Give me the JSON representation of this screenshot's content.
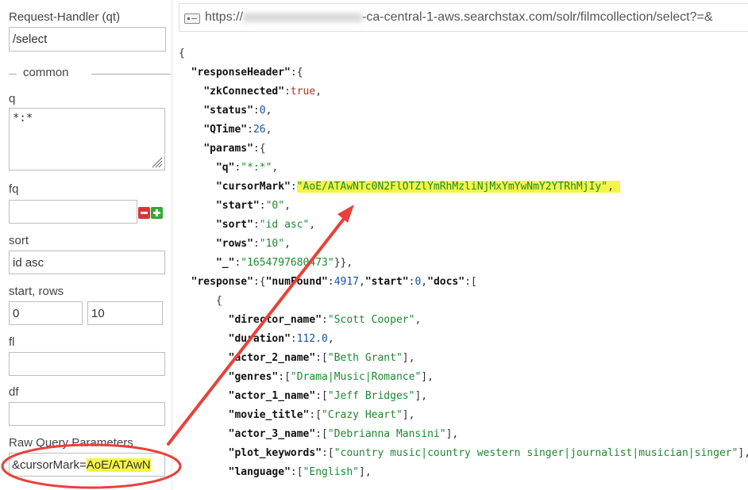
{
  "form": {
    "request_handler": {
      "label": "Request-Handler (qt)",
      "value": "/select"
    },
    "section_common": "common",
    "q": {
      "label": "q",
      "value": "*:*"
    },
    "fq": {
      "label": "fq",
      "value": ""
    },
    "sort": {
      "label": "sort",
      "value": "id asc"
    },
    "start_rows": {
      "label": "start, rows",
      "start": "0",
      "rows": "10"
    },
    "fl": {
      "label": "fl",
      "value": ""
    },
    "df": {
      "label": "df",
      "value": ""
    },
    "raw": {
      "label": "Raw Query Parameters",
      "prefix": "&cursorMark=",
      "highlighted": "AoE/ATAwN"
    }
  },
  "url_bar": {
    "prefix": "https://",
    "suffix": "-ca-central-1-aws.searchstax.com/solr/filmcollection/select?=&"
  },
  "json_lines": [
    "{",
    "  <span class='k'>\"responseHeader\"</span>:{",
    "    <span class='k'>\"zkConnected\"</span>:<span class='b'>true</span>,",
    "    <span class='k'>\"status\"</span>:<span class='n'>0</span>,",
    "    <span class='k'>\"QTime\"</span>:<span class='n'>26</span>,",
    "    <span class='k'>\"params\"</span>:{",
    "      <span class='k'>\"q\"</span>:<span class='s'>\"*:*\"</span>,",
    "      <span class='k'>\"cursorMark\"</span>:<span class='hl'><span class='s'>\"AoE/ATAwNTc0N2FlOTZlYmRhMzliNjMxYmYwNmY2YTRhMjIy\"</span>, </span>",
    "      <span class='k'>\"start\"</span>:<span class='s'>\"0\"</span>,",
    "      <span class='k'>\"sort\"</span>:<span class='s'>\"id asc\"</span>,",
    "      <span class='k'>\"rows\"</span>:<span class='s'>\"10\"</span>,",
    "      <span class='k'>\"_\"</span>:<span class='s'>\"1654797680473\"</span>}},",
    "  <span class='k'>\"response\"</span>:{<span class='k'>\"numFound\"</span>:<span class='n'>4917</span>,<span class='k'>\"start\"</span>:<span class='n'>0</span>,<span class='k'>\"docs\"</span>:[",
    "      {",
    "        <span class='k'>\"director_name\"</span>:<span class='s'>\"Scott Cooper\"</span>,",
    "        <span class='k'>\"duration\"</span>:<span class='n'>112.0</span>,",
    "        <span class='k'>\"actor_2_name\"</span>:[<span class='s'>\"Beth Grant\"</span>],",
    "        <span class='k'>\"genres\"</span>:[<span class='s'>\"Drama|Music|Romance\"</span>],",
    "        <span class='k'>\"actor_1_name\"</span>:[<span class='s'>\"Jeff Bridges\"</span>],",
    "        <span class='k'>\"movie_title\"</span>:[<span class='s'>\"Crazy Heart\"</span>],",
    "        <span class='k'>\"actor_3_name\"</span>:[<span class='s'>\"Debrianna Mansini\"</span>],",
    "        <span class='k'>\"plot_keywords\"</span>:[<span class='s'>\"country music|country western singer|journalist|musician|singer\"</span>],",
    "        <span class='k'>\"language\"</span>:[<span class='s'>\"English\"</span>],"
  ],
  "colors": {
    "highlight": "#f5f545",
    "annotation": "#e8413b",
    "string": "#1c8a2e",
    "number": "#1a4fa8",
    "boolean": "#b03020"
  }
}
